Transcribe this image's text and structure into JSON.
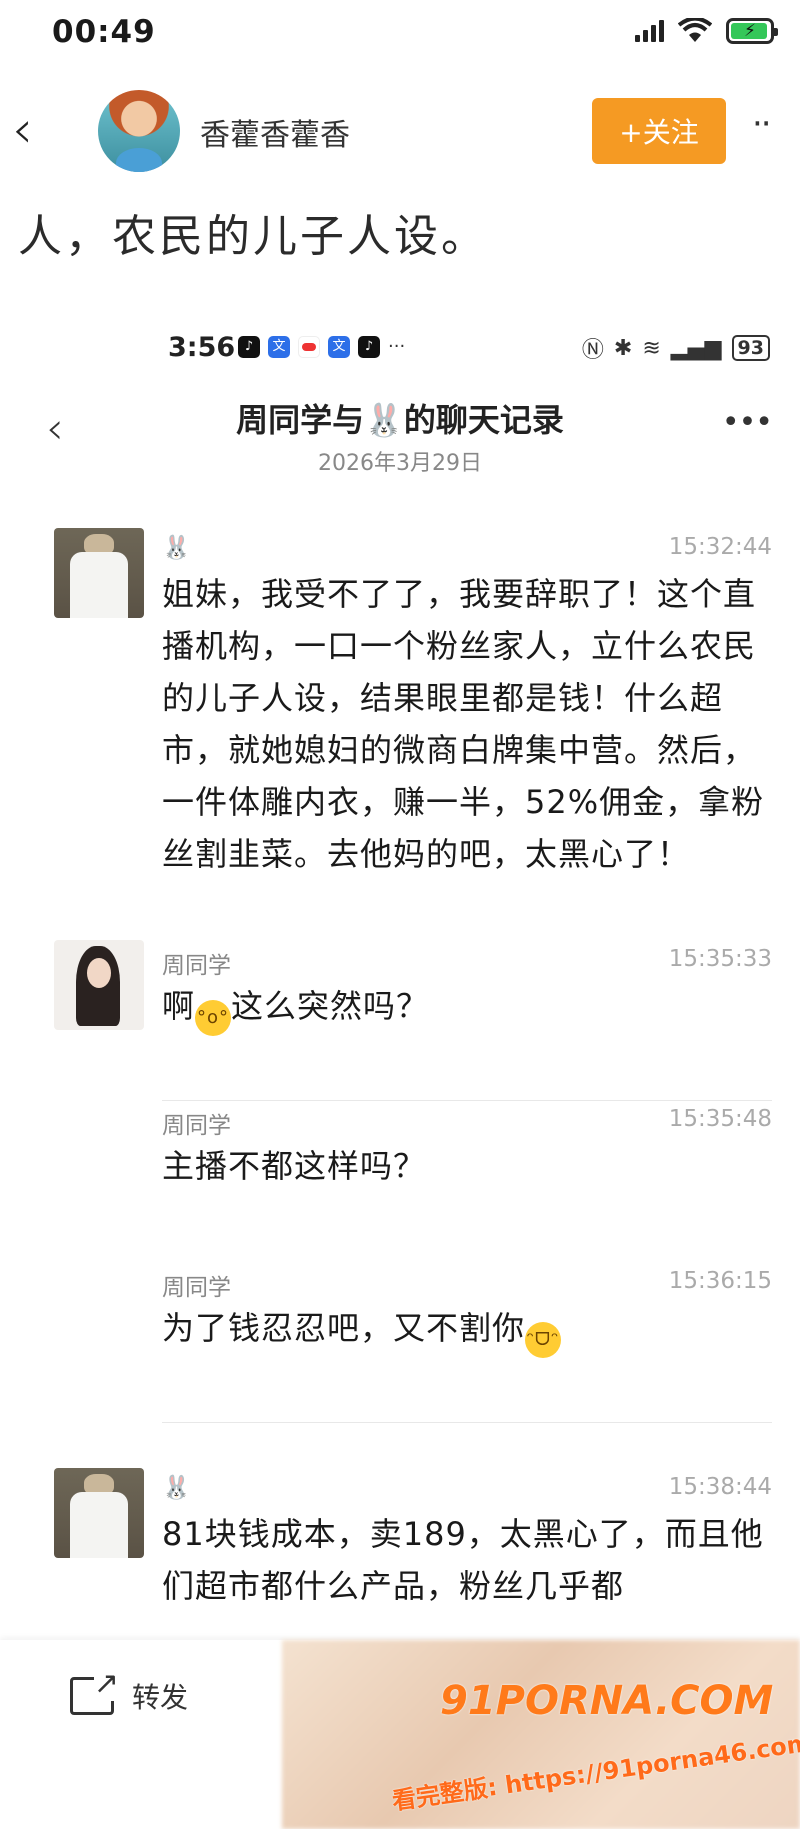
{
  "status": {
    "time": "00:49"
  },
  "header": {
    "username": "香藿香藿香",
    "follow_label": "+关注",
    "more": "··"
  },
  "intro_text": "人，农民的儿子人设。",
  "inner": {
    "time": "3:56",
    "battery": "93",
    "title": "周同学与🐰的聊天记录",
    "date": "2026年3月29日",
    "messages": [
      {
        "name": "🐰",
        "time": "15:32:44",
        "text": "姐妹，我受不了了，我要辞职了！这个直播机构，一口一个粉丝家人，立什么农民的儿子人设，结果眼里都是钱！什么超市，就她媳妇的微商白牌集中营。然后，一件体雕内衣，赚一半，52%佣金，拿粉丝割韭菜。去他妈的吧，太黑心了！"
      },
      {
        "name": "周同学",
        "time": "15:35:33",
        "text_a": "啊",
        "text_b": "这么突然吗？"
      },
      {
        "name": "周同学",
        "time": "15:35:48",
        "text": "主播不都这样吗？"
      },
      {
        "name": "周同学",
        "time": "15:36:15",
        "text": "为了钱忍忍吧，又不割你"
      },
      {
        "name": "🐰",
        "time": "15:38:44",
        "text": "81块钱成本，卖189，太黑心了，而且他们超市都什么产品，粉丝几乎都"
      }
    ]
  },
  "bottom": {
    "share_label": "转发",
    "watermark": "91PORNA.COM",
    "watermark_sub": "看完整版: https://91porna46.com"
  }
}
